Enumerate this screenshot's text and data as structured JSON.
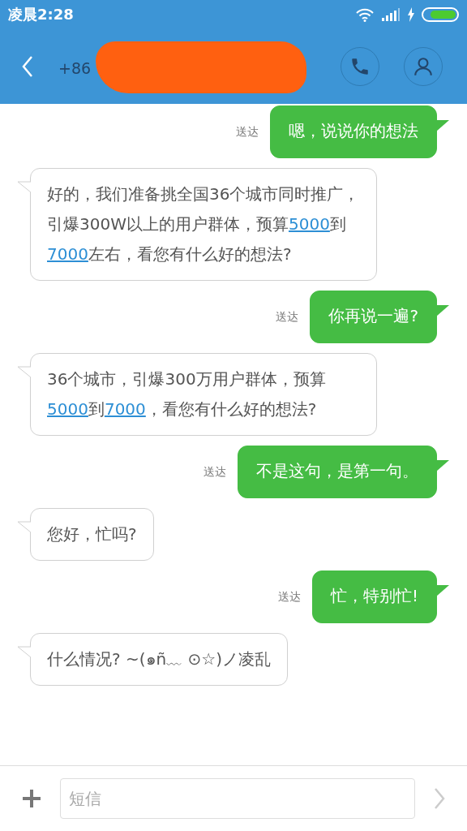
{
  "status_bar": {
    "time": "凌晨2:28"
  },
  "header": {
    "number": "+86"
  },
  "messages": [
    {
      "kind": "sent",
      "status": "送达",
      "parts": [
        {
          "text": "嗯，说说你的想法",
          "link": false
        }
      ]
    },
    {
      "kind": "received",
      "parts": [
        {
          "text": "好的，我们准备挑全国36个城市同时推广，引爆300W以上的用户群体，预算",
          "link": false
        },
        {
          "text": "5000",
          "link": true
        },
        {
          "text": "到",
          "link": false
        },
        {
          "text": "7000",
          "link": true
        },
        {
          "text": "左右，看您有什么好的想法?",
          "link": false
        }
      ]
    },
    {
      "kind": "sent",
      "status": "送达",
      "parts": [
        {
          "text": "你再说一遍?",
          "link": false
        }
      ]
    },
    {
      "kind": "received",
      "parts": [
        {
          "text": "36个城市，引爆300万用户群体，预算",
          "link": false
        },
        {
          "text": "5000",
          "link": true
        },
        {
          "text": "到",
          "link": false
        },
        {
          "text": "7000",
          "link": true
        },
        {
          "text": "，看您有什么好的想法?",
          "link": false
        }
      ]
    },
    {
      "kind": "sent",
      "status": "送达",
      "parts": [
        {
          "text": "不是这句，是第一句。",
          "link": false
        }
      ]
    },
    {
      "kind": "received",
      "parts": [
        {
          "text": "您好，忙吗?",
          "link": false
        }
      ]
    },
    {
      "kind": "sent",
      "status": "送达",
      "parts": [
        {
          "text": "忙，特别忙!",
          "link": false
        }
      ]
    },
    {
      "kind": "received",
      "parts": [
        {
          "text": "什么情况? ~(๑ñ﹏ ⊙☆)ノ凌乱",
          "link": false
        }
      ]
    }
  ],
  "composer": {
    "placeholder": "短信"
  }
}
